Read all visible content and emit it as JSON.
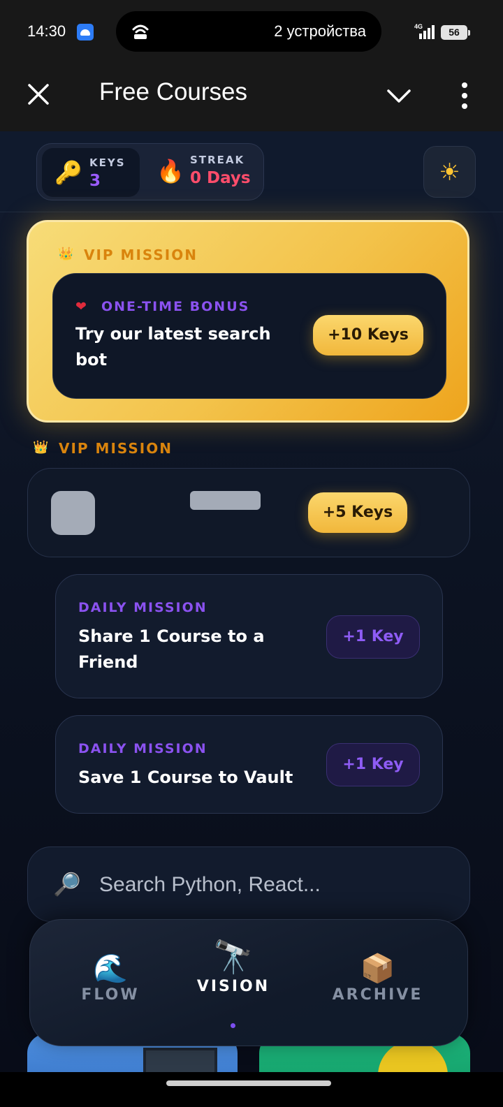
{
  "status_bar": {
    "time": "14:30",
    "hotspot_text": "2 устройства",
    "network_label": "4G",
    "battery": "56"
  },
  "app_bar": {
    "title": "Free Courses"
  },
  "stats": {
    "keys_label": "KEYS",
    "keys_value": "3",
    "keys_emoji": "🔑",
    "streak_label": "STREAK",
    "streak_value": "0 Days",
    "streak_emoji": "🔥",
    "theme_icon": "☀"
  },
  "vip_mission_1": {
    "label": "VIP MISSION",
    "crown": "👑",
    "tag_icon": "❤",
    "tag": "ONE-TIME BONUS",
    "text": "Try our latest search bot",
    "reward": "+10 Keys"
  },
  "vip_mission_2": {
    "label": "VIP MISSION",
    "crown": "👑",
    "reward": "+5 Keys"
  },
  "daily_missions": [
    {
      "tag": "DAILY MISSION",
      "text": "Share 1 Course to a Friend",
      "reward": "+1 Key"
    },
    {
      "tag": "DAILY MISSION",
      "text": "Save 1 Course to Vault",
      "reward": "+1 Key"
    }
  ],
  "search": {
    "icon": "🔎",
    "placeholder": "Search Python, React..."
  },
  "bottom_nav": {
    "items": [
      {
        "label": "FLOW",
        "icon": "🌊"
      },
      {
        "label": "VISION",
        "icon": "🔭"
      },
      {
        "label": "ARCHIVE",
        "icon": "📦"
      }
    ],
    "active_index": 1
  },
  "colors": {
    "accent_purple": "#8b52f0",
    "gold": "#f3c34b",
    "streak_red": "#ff4d6b",
    "keys_purple": "#9b5cff"
  }
}
